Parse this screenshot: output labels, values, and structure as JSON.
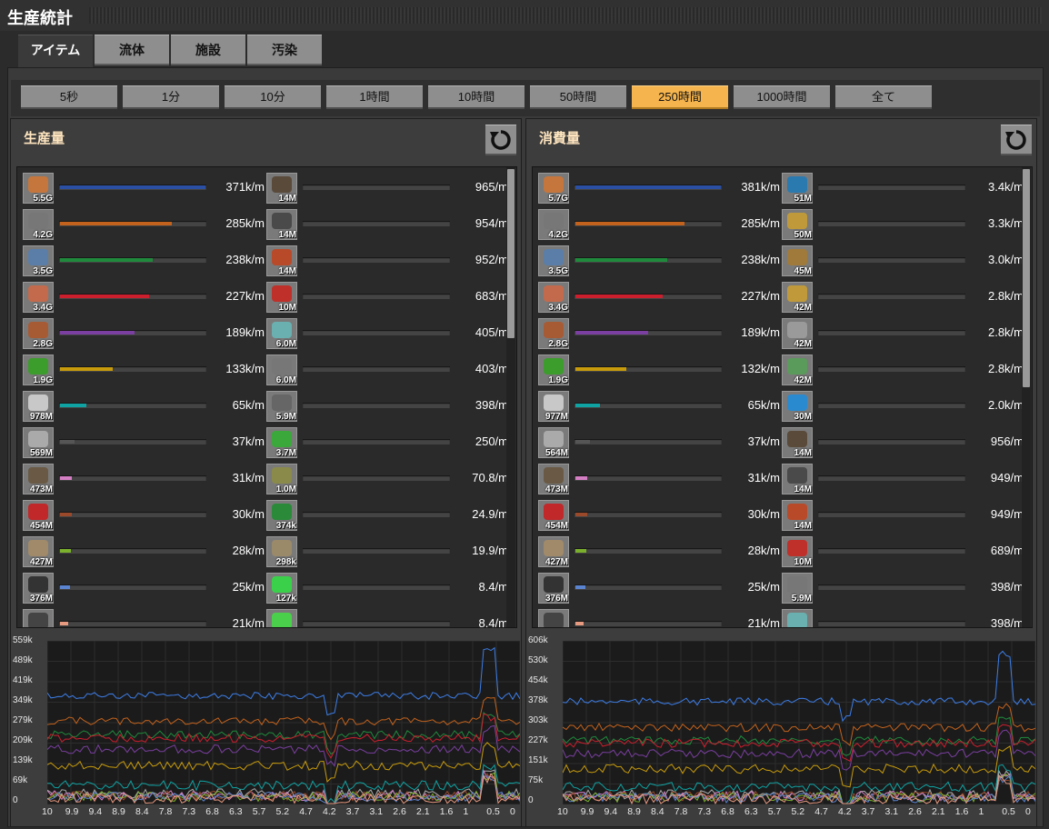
{
  "window": {
    "title": "生産統計"
  },
  "tabs": [
    {
      "label": "アイテム",
      "active": true
    },
    {
      "label": "流体",
      "active": false
    },
    {
      "label": "施設",
      "active": false
    },
    {
      "label": "汚染",
      "active": false
    }
  ],
  "time_buttons": [
    {
      "label": "5秒",
      "active": false
    },
    {
      "label": "1分",
      "active": false
    },
    {
      "label": "10分",
      "active": false
    },
    {
      "label": "1時間",
      "active": false
    },
    {
      "label": "10時間",
      "active": false
    },
    {
      "label": "50時間",
      "active": false
    },
    {
      "label": "250時間",
      "active": true
    },
    {
      "label": "1000時間",
      "active": false
    },
    {
      "label": "全て",
      "active": false
    }
  ],
  "colors": {
    "accent": "#f5b44d",
    "title": "#ffe6c0"
  },
  "production": {
    "title": "生産量",
    "left": [
      {
        "icon": "copper-cable-icon",
        "count": "5.5G",
        "rate": "371k/m",
        "fill": 1.0,
        "color": "#2a4fa3",
        "gcolor": "#c5763c"
      },
      {
        "icon": "stone-icon",
        "count": "4.2G",
        "rate": "285k/m",
        "fill": 0.77,
        "color": "#c3621c",
        "gcolor": "#777"
      },
      {
        "icon": "iron-ore-icon",
        "count": "3.5G",
        "rate": "238k/m",
        "fill": 0.64,
        "color": "#1f8a3c",
        "gcolor": "#5a7ea8"
      },
      {
        "icon": "copper-plate-icon",
        "count": "3.4G",
        "rate": "227k/m",
        "fill": 0.61,
        "color": "#cc1f2e",
        "gcolor": "#c36a4c"
      },
      {
        "icon": "copper-ore-icon",
        "count": "2.8G",
        "rate": "189k/m",
        "fill": 0.51,
        "color": "#7a3fa0",
        "gcolor": "#a75b35"
      },
      {
        "icon": "electronic-circuit-icon",
        "count": "1.9G",
        "rate": "133k/m",
        "fill": 0.36,
        "color": "#c79b0c",
        "gcolor": "#3c9c2c"
      },
      {
        "icon": "iron-plate-icon",
        "count": "978M",
        "rate": "65k/m",
        "fill": 0.18,
        "color": "#10a3a3",
        "gcolor": "#c8c8c8"
      },
      {
        "icon": "iron-stick-icon",
        "count": "569M",
        "rate": "37k/m",
        "fill": 0.1,
        "color": "#555",
        "gcolor": "#aaa"
      },
      {
        "icon": "coal-icon",
        "count": "473M",
        "rate": "31k/m",
        "fill": 0.08,
        "color": "#d47fc4",
        "gcolor": "#6a5a45"
      },
      {
        "icon": "advanced-circuit-icon",
        "count": "454M",
        "rate": "30k/m",
        "fill": 0.08,
        "color": "#9a4a2a",
        "gcolor": "#c0282a"
      },
      {
        "icon": "rail-icon",
        "count": "427M",
        "rate": "28k/m",
        "fill": 0.075,
        "color": "#7ab02c",
        "gcolor": "#a08a6a"
      },
      {
        "icon": "coal-lump-icon",
        "count": "376M",
        "rate": "25k/m",
        "fill": 0.067,
        "color": "#5b84d0",
        "gcolor": "#333"
      },
      {
        "icon": "steel-plate-icon",
        "count": "",
        "rate": "21k/m",
        "fill": 0.056,
        "color": "#e89a80",
        "gcolor": "#444"
      }
    ],
    "right": [
      {
        "icon": "engine-unit-icon",
        "count": "14M",
        "rate": "965/m",
        "fill": 0.0,
        "color": "#555",
        "gcolor": "#5a4a3a"
      },
      {
        "icon": "battery-icon",
        "count": "14M",
        "rate": "954/m",
        "fill": 0.0,
        "color": "#555",
        "gcolor": "#4a4a4a"
      },
      {
        "icon": "assembler-icon",
        "count": "14M",
        "rate": "952/m",
        "fill": 0.0,
        "color": "#555",
        "gcolor": "#b84a2a"
      },
      {
        "icon": "red-wire-icon",
        "count": "10M",
        "rate": "683/m",
        "fill": 0.0,
        "color": "#555",
        "gcolor": "#c0302a"
      },
      {
        "icon": "solar-icon",
        "count": "6.0M",
        "rate": "405/m",
        "fill": 0.0,
        "color": "#555",
        "gcolor": "#6ab0b0"
      },
      {
        "icon": "wall-icon",
        "count": "6.0M",
        "rate": "403/m",
        "fill": 0.0,
        "color": "#555",
        "gcolor": "#777"
      },
      {
        "icon": "robot-icon",
        "count": "5.9M",
        "rate": "398/m",
        "fill": 0.0,
        "color": "#555",
        "gcolor": "#666"
      },
      {
        "icon": "wood-icon",
        "count": "3.7M",
        "rate": "250/m",
        "fill": 0.0,
        "color": "#555",
        "gcolor": "#3aa83a"
      },
      {
        "icon": "landfill-icon",
        "count": "1.0M",
        "rate": "70.8/m",
        "fill": 0.0,
        "color": "#555",
        "gcolor": "#8a8a4a"
      },
      {
        "icon": "green-module-icon",
        "count": "374k",
        "rate": "24.9/m",
        "fill": 0.0,
        "color": "#555",
        "gcolor": "#2a8a3a"
      },
      {
        "icon": "drill-icon",
        "count": "298k",
        "rate": "19.9/m",
        "fill": 0.0,
        "color": "#555",
        "gcolor": "#9a8a6a"
      },
      {
        "icon": "module-icon",
        "count": "127k",
        "rate": "8.4/m",
        "fill": 0.0,
        "color": "#555",
        "gcolor": "#3ad04a"
      },
      {
        "icon": "crystal-icon",
        "count": "",
        "rate": "8.4/m",
        "fill": 0.0,
        "color": "#555",
        "gcolor": "#4ad04a"
      }
    ],
    "graph": {
      "yticks": [
        "559k",
        "489k",
        "419k",
        "349k",
        "279k",
        "209k",
        "139k",
        "69k",
        "0"
      ],
      "xticks": [
        "10",
        "9.9",
        "9.4",
        "8.9",
        "8.4",
        "7.8",
        "7.3",
        "6.8",
        "6.3",
        "5.7",
        "5.2",
        "4.7",
        "4.2",
        "3.7",
        "3.1",
        "2.6",
        "2.1",
        "1.6",
        "1",
        "0.5",
        "0"
      ]
    }
  },
  "consumption": {
    "title": "消費量",
    "left": [
      {
        "icon": "copper-cable-icon",
        "count": "5.7G",
        "rate": "381k/m",
        "fill": 1.0,
        "color": "#2a4fa3",
        "gcolor": "#c5763c"
      },
      {
        "icon": "stone-icon",
        "count": "4.2G",
        "rate": "285k/m",
        "fill": 0.75,
        "color": "#c3621c",
        "gcolor": "#777"
      },
      {
        "icon": "iron-ore-icon",
        "count": "3.5G",
        "rate": "238k/m",
        "fill": 0.63,
        "color": "#1f8a3c",
        "gcolor": "#5a7ea8"
      },
      {
        "icon": "copper-plate-icon",
        "count": "3.4G",
        "rate": "227k/m",
        "fill": 0.6,
        "color": "#cc1f2e",
        "gcolor": "#c36a4c"
      },
      {
        "icon": "copper-ore-icon",
        "count": "2.8G",
        "rate": "189k/m",
        "fill": 0.5,
        "color": "#7a3fa0",
        "gcolor": "#a75b35"
      },
      {
        "icon": "electronic-circuit-icon",
        "count": "1.9G",
        "rate": "132k/m",
        "fill": 0.35,
        "color": "#c79b0c",
        "gcolor": "#3c9c2c"
      },
      {
        "icon": "iron-plate-icon",
        "count": "977M",
        "rate": "65k/m",
        "fill": 0.17,
        "color": "#10a3a3",
        "gcolor": "#c8c8c8"
      },
      {
        "icon": "iron-stick-icon",
        "count": "564M",
        "rate": "37k/m",
        "fill": 0.1,
        "color": "#555",
        "gcolor": "#aaa"
      },
      {
        "icon": "coal-icon",
        "count": "473M",
        "rate": "31k/m",
        "fill": 0.08,
        "color": "#d47fc4",
        "gcolor": "#6a5a45"
      },
      {
        "icon": "advanced-circuit-icon",
        "count": "454M",
        "rate": "30k/m",
        "fill": 0.08,
        "color": "#9a4a2a",
        "gcolor": "#c0282a"
      },
      {
        "icon": "rail-icon",
        "count": "427M",
        "rate": "28k/m",
        "fill": 0.074,
        "color": "#7ab02c",
        "gcolor": "#a08a6a"
      },
      {
        "icon": "coal-lump-icon",
        "count": "376M",
        "rate": "25k/m",
        "fill": 0.066,
        "color": "#5b84d0",
        "gcolor": "#333"
      },
      {
        "icon": "steel-plate-icon",
        "count": "",
        "rate": "21k/m",
        "fill": 0.055,
        "color": "#e89a80",
        "gcolor": "#444"
      }
    ],
    "right": [
      {
        "icon": "red-belt-icon",
        "count": "51M",
        "rate": "3.4k/m",
        "fill": 0.0,
        "color": "#555",
        "gcolor": "#2a7ab0"
      },
      {
        "icon": "gear-icon",
        "count": "50M",
        "rate": "3.3k/m",
        "fill": 0.0,
        "color": "#555",
        "gcolor": "#c09a3a"
      },
      {
        "icon": "pipe-icon",
        "count": "45M",
        "rate": "3.0k/m",
        "fill": 0.0,
        "color": "#555",
        "gcolor": "#a07a3a"
      },
      {
        "icon": "inserter-icon",
        "count": "42M",
        "rate": "2.8k/m",
        "fill": 0.0,
        "color": "#555",
        "gcolor": "#c09a3a"
      },
      {
        "icon": "furnace-icon",
        "count": "42M",
        "rate": "2.8k/m",
        "fill": 0.0,
        "color": "#555",
        "gcolor": "#9a9a9a"
      },
      {
        "icon": "circuit-board-icon",
        "count": "42M",
        "rate": "2.8k/m",
        "fill": 0.0,
        "color": "#555",
        "gcolor": "#5a9a5a"
      },
      {
        "icon": "blue-robot-icon",
        "count": "30M",
        "rate": "2.0k/m",
        "fill": 0.0,
        "color": "#555",
        "gcolor": "#2a8ad0"
      },
      {
        "icon": "engine-unit-icon",
        "count": "14M",
        "rate": "956/m",
        "fill": 0.0,
        "color": "#555",
        "gcolor": "#5a4a3a"
      },
      {
        "icon": "battery-icon",
        "count": "14M",
        "rate": "949/m",
        "fill": 0.0,
        "color": "#555",
        "gcolor": "#4a4a4a"
      },
      {
        "icon": "assembler-icon",
        "count": "14M",
        "rate": "949/m",
        "fill": 0.0,
        "color": "#555",
        "gcolor": "#b84a2a"
      },
      {
        "icon": "red-wire-icon",
        "count": "10M",
        "rate": "689/m",
        "fill": 0.0,
        "color": "#555",
        "gcolor": "#c0302a"
      },
      {
        "icon": "wall-icon",
        "count": "5.9M",
        "rate": "398/m",
        "fill": 0.0,
        "color": "#555",
        "gcolor": "#777"
      },
      {
        "icon": "solar-icon",
        "count": "",
        "rate": "398/m",
        "fill": 0.0,
        "color": "#555",
        "gcolor": "#6ab0b0"
      }
    ],
    "graph": {
      "yticks": [
        "606k",
        "530k",
        "454k",
        "378k",
        "303k",
        "227k",
        "151k",
        "75k",
        "0"
      ],
      "xticks": [
        "10",
        "9.9",
        "9.4",
        "8.9",
        "8.4",
        "7.8",
        "7.3",
        "6.8",
        "6.3",
        "5.7",
        "5.2",
        "4.7",
        "4.2",
        "3.7",
        "3.1",
        "2.6",
        "2.1",
        "1.6",
        "1",
        "0.5",
        "0"
      ]
    }
  }
}
